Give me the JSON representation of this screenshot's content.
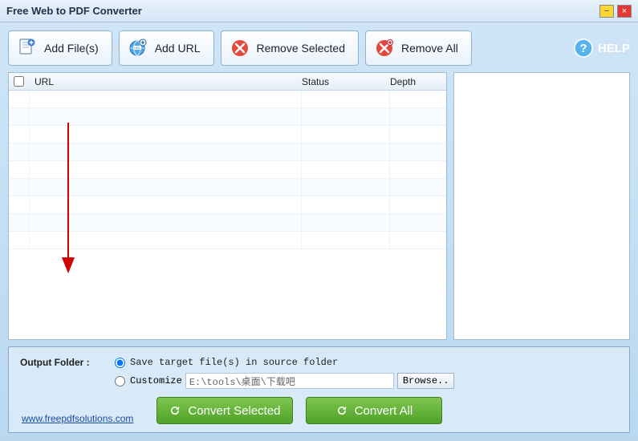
{
  "window": {
    "title": "Free Web to PDF Converter"
  },
  "toolbar": {
    "add_files": "Add File(s)",
    "add_url": "Add URL",
    "remove_selected": "Remove Selected",
    "remove_all": "Remove All",
    "help": "HELP"
  },
  "table": {
    "columns": {
      "url": "URL",
      "status": "Status",
      "depth": "Depth"
    },
    "rows": []
  },
  "output": {
    "label": "Output Folder :",
    "save_source_label": "Save target file(s) in source folder",
    "customize_label": "Customize",
    "path_value": "E:\\tools\\桌面\\下载吧",
    "browse": "Browse..",
    "selected_option": "save_source"
  },
  "actions": {
    "convert_selected": "Convert Selected",
    "convert_all": "Convert All"
  },
  "footer": {
    "link": "www.freepdfsolutions.com"
  },
  "colors": {
    "accent_green": "#5fb336",
    "accent_red": "#e2483b",
    "panel_blue": "#cfe5f7"
  }
}
